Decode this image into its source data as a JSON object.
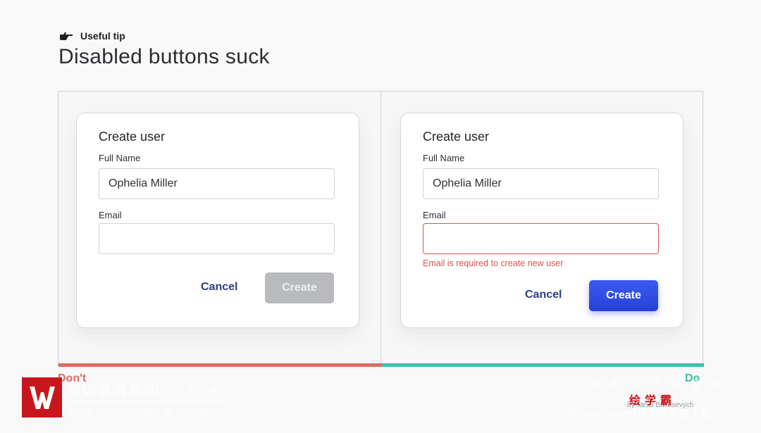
{
  "header": {
    "tip_label": "Useful tip",
    "title": "Disabled buttons suck"
  },
  "dont_example": {
    "form_title": "Create user",
    "name_label": "Full Name",
    "name_value": "Ophelia Miller",
    "email_label": "Email",
    "email_value": "",
    "cancel_label": "Cancel",
    "create_label": "Create",
    "verdict": "Don't"
  },
  "do_example": {
    "form_title": "Create user",
    "name_label": "Full Name",
    "name_value": "Ophelia Miller",
    "email_label": "Email",
    "email_value": "",
    "error_message": "Email is required to create new user",
    "cancel_label": "Cancel",
    "create_label": "Create",
    "verdict": "Do"
  },
  "credit": "by Taras Bakusevych",
  "watermark": {
    "left_title": "培训教育集团",
    "left_small": "数人为本",
    "left_sub": "创新不二教学三年",
    "right_top": "扫码关注获取更多",
    "right_brand": "绘学霸",
    "right_bottom": "在AppStore中搜索绘学霸下载"
  },
  "colors": {
    "dont_accent": "#e06b62",
    "do_accent": "#3cbfa8",
    "primary_button": "#2f4fe6",
    "disabled_button": "#b8babd",
    "error": "#d9544c",
    "link": "#2d3f86"
  }
}
